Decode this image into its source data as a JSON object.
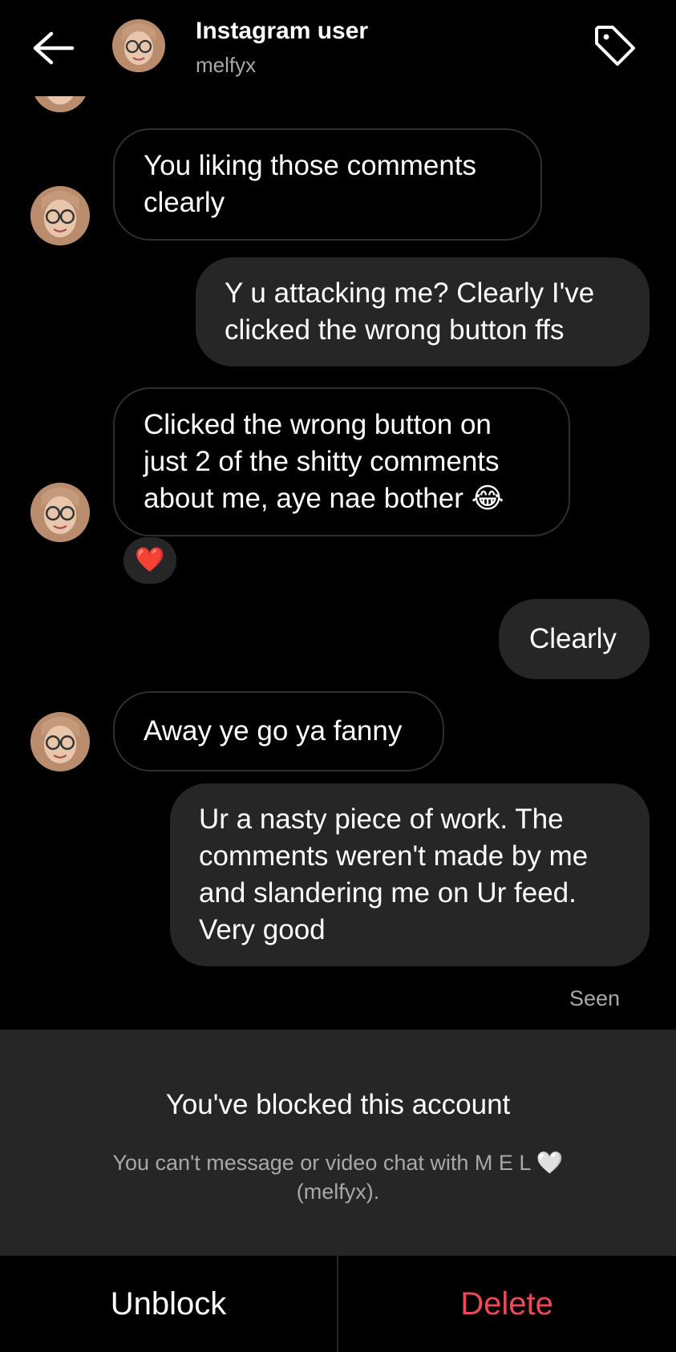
{
  "header": {
    "title": "Instagram user",
    "username": "melfyx"
  },
  "messages": [
    {
      "side": "in",
      "text": "You liking those comments clearly"
    },
    {
      "side": "out",
      "text": "Y u attacking me? Clearly I've clicked the wrong button ffs"
    },
    {
      "side": "in",
      "text": "Clicked the wrong button on just 2 of the shitty comments about me, aye nae bother 😂",
      "reaction": "❤️"
    },
    {
      "side": "out",
      "text": "Clearly"
    },
    {
      "side": "in",
      "text": "Away ye go ya fanny"
    },
    {
      "side": "out",
      "text": "Ur a nasty piece of work. The comments weren't made by me and slandering me on Ur feed. Very good"
    }
  ],
  "status": {
    "seen": "Seen"
  },
  "blocked": {
    "title": "You've blocked this account",
    "description": "You can't message or video chat with M E L 🤍 (melfyx)."
  },
  "actions": {
    "unblock_label": "Unblock",
    "delete_label": "Delete"
  },
  "colors": {
    "background": "#000000",
    "outgoing_bubble": "#262626",
    "delete": "#ed4956"
  }
}
